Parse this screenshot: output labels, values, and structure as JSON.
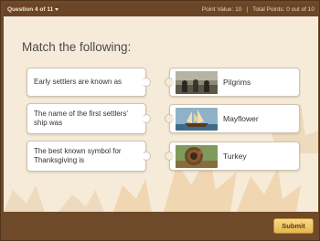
{
  "header": {
    "question_label": "Question 4 of 11",
    "point_value_label": "Point Value: 10",
    "total_points_label": "Total Points: 0 out of 10"
  },
  "main": {
    "title": "Match the following:",
    "prompts": [
      {
        "text": "Early settlers are known as"
      },
      {
        "text": "The name of the first settlers' ship was"
      },
      {
        "text": "The best known symbol for Thanksgiving is"
      }
    ],
    "answers": [
      {
        "label": "Pilgrims",
        "image": "pilgrims-photo"
      },
      {
        "label": "Mayflower",
        "image": "ship-photo"
      },
      {
        "label": "Turkey",
        "image": "turkey-photo"
      }
    ]
  },
  "footer": {
    "submit_label": "Submit"
  },
  "colors": {
    "frame": "#6e4a2a",
    "background": "#f6ebd8",
    "submit": "#e6b54f"
  }
}
